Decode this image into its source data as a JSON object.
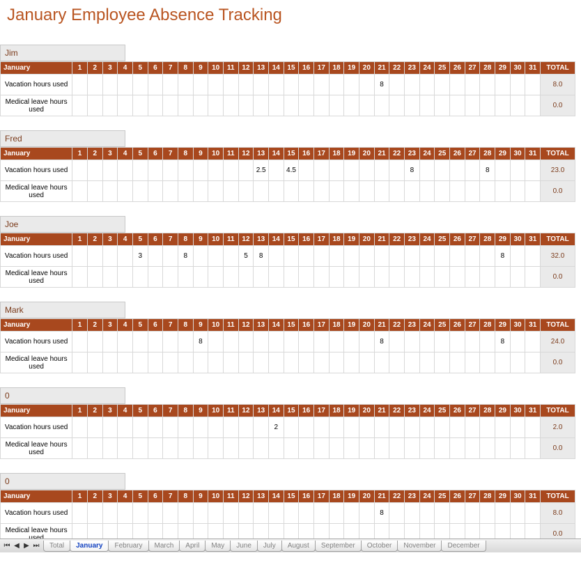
{
  "title": "January Employee Absence Tracking",
  "month_label": "January",
  "total_label": "TOTAL",
  "row_labels": {
    "vacation": "Vacation hours used",
    "medical": "Medical leave hours used"
  },
  "days": [
    "1",
    "2",
    "3",
    "4",
    "5",
    "6",
    "7",
    "8",
    "9",
    "10",
    "11",
    "12",
    "13",
    "14",
    "15",
    "16",
    "17",
    "18",
    "19",
    "20",
    "21",
    "22",
    "23",
    "24",
    "25",
    "26",
    "27",
    "28",
    "29",
    "30",
    "31"
  ],
  "employees": [
    {
      "name": "Jim",
      "vacation": {
        "21": "8"
      },
      "vacation_total": "8.0",
      "medical": {},
      "medical_total": "0.0"
    },
    {
      "name": "Fred",
      "vacation": {
        "13": "2.5",
        "15": "4.5",
        "23": "8",
        "28": "8"
      },
      "vacation_total": "23.0",
      "medical": {},
      "medical_total": "0.0"
    },
    {
      "name": "Joe",
      "vacation": {
        "5": "3",
        "8": "8",
        "12": "5",
        "13": "8",
        "29": "8"
      },
      "vacation_total": "32.0",
      "medical": {},
      "medical_total": "0.0"
    },
    {
      "name": "Mark",
      "vacation": {
        "9": "8",
        "21": "8",
        "29": "8"
      },
      "vacation_total": "24.0",
      "medical": {},
      "medical_total": "0.0"
    },
    {
      "name": "0",
      "vacation": {
        "14": "2"
      },
      "vacation_total": "2.0",
      "medical": {},
      "medical_total": "0.0"
    },
    {
      "name": "0",
      "vacation": {
        "21": "8"
      },
      "vacation_total": "8.0",
      "medical": {},
      "medical_total": "0.0"
    }
  ],
  "tabs": [
    "Total",
    "January",
    "February",
    "March",
    "April",
    "May",
    "June",
    "July",
    "August",
    "September",
    "October",
    "November",
    "December"
  ],
  "active_tab": "January",
  "chart_data": {
    "type": "table",
    "title": "January Employee Absence Tracking",
    "columns": [
      "Employee",
      "Metric",
      "1",
      "2",
      "3",
      "4",
      "5",
      "6",
      "7",
      "8",
      "9",
      "10",
      "11",
      "12",
      "13",
      "14",
      "15",
      "16",
      "17",
      "18",
      "19",
      "20",
      "21",
      "22",
      "23",
      "24",
      "25",
      "26",
      "27",
      "28",
      "29",
      "30",
      "31",
      "TOTAL"
    ],
    "rows": [
      [
        "Jim",
        "Vacation hours used",
        "",
        "",
        "",
        "",
        "",
        "",
        "",
        "",
        "",
        "",
        "",
        "",
        "",
        "",
        "",
        "",
        "",
        "",
        "",
        "",
        "8",
        "",
        "",
        "",
        "",
        "",
        "",
        "",
        "",
        "",
        "",
        "8.0"
      ],
      [
        "Jim",
        "Medical leave hours used",
        "",
        "",
        "",
        "",
        "",
        "",
        "",
        "",
        "",
        "",
        "",
        "",
        "",
        "",
        "",
        "",
        "",
        "",
        "",
        "",
        "",
        "",
        "",
        "",
        "",
        "",
        "",
        "",
        "",
        "",
        "",
        "0.0"
      ],
      [
        "Fred",
        "Vacation hours used",
        "",
        "",
        "",
        "",
        "",
        "",
        "",
        "",
        "",
        "",
        "",
        "",
        "2.5",
        "",
        "4.5",
        "",
        "",
        "",
        "",
        "",
        "",
        "",
        "8",
        "",
        "",
        "",
        "",
        "8",
        "",
        "",
        "",
        "23.0"
      ],
      [
        "Fred",
        "Medical leave hours used",
        "",
        "",
        "",
        "",
        "",
        "",
        "",
        "",
        "",
        "",
        "",
        "",
        "",
        "",
        "",
        "",
        "",
        "",
        "",
        "",
        "",
        "",
        "",
        "",
        "",
        "",
        "",
        "",
        "",
        "",
        "",
        "0.0"
      ],
      [
        "Joe",
        "Vacation hours used",
        "",
        "",
        "",
        "",
        "3",
        "",
        "",
        "8",
        "",
        "",
        "",
        "5",
        "8",
        "",
        "",
        "",
        "",
        "",
        "",
        "",
        "",
        "",
        "",
        "",
        "",
        "",
        "",
        "",
        "8",
        "",
        "",
        "32.0"
      ],
      [
        "Joe",
        "Medical leave hours used",
        "",
        "",
        "",
        "",
        "",
        "",
        "",
        "",
        "",
        "",
        "",
        "",
        "",
        "",
        "",
        "",
        "",
        "",
        "",
        "",
        "",
        "",
        "",
        "",
        "",
        "",
        "",
        "",
        "",
        "",
        "",
        "0.0"
      ],
      [
        "Mark",
        "Vacation hours used",
        "",
        "",
        "",
        "",
        "",
        "",
        "",
        "",
        "8",
        "",
        "",
        "",
        "",
        "",
        "",
        "",
        "",
        "",
        "",
        "",
        "8",
        "",
        "",
        "",
        "",
        "",
        "",
        "",
        "8",
        "",
        "",
        "24.0"
      ],
      [
        "Mark",
        "Medical leave hours used",
        "",
        "",
        "",
        "",
        "",
        "",
        "",
        "",
        "",
        "",
        "",
        "",
        "",
        "",
        "",
        "",
        "",
        "",
        "",
        "",
        "",
        "",
        "",
        "",
        "",
        "",
        "",
        "",
        "",
        "",
        "",
        "0.0"
      ],
      [
        "0",
        "Vacation hours used",
        "",
        "",
        "",
        "",
        "",
        "",
        "",
        "",
        "",
        "",
        "",
        "",
        "",
        "2",
        "",
        "",
        "",
        "",
        "",
        "",
        "",
        "",
        "",
        "",
        "",
        "",
        "",
        "",
        "",
        "",
        "",
        "2.0"
      ],
      [
        "0",
        "Medical leave hours used",
        "",
        "",
        "",
        "",
        "",
        "",
        "",
        "",
        "",
        "",
        "",
        "",
        "",
        "",
        "",
        "",
        "",
        "",
        "",
        "",
        "",
        "",
        "",
        "",
        "",
        "",
        "",
        "",
        "",
        "",
        "",
        "0.0"
      ],
      [
        "0",
        "Vacation hours used",
        "",
        "",
        "",
        "",
        "",
        "",
        "",
        "",
        "",
        "",
        "",
        "",
        "",
        "",
        "",
        "",
        "",
        "",
        "",
        "",
        "8",
        "",
        "",
        "",
        "",
        "",
        "",
        "",
        "",
        "",
        "",
        "8.0"
      ],
      [
        "0",
        "Medical leave hours used",
        "",
        "",
        "",
        "",
        "",
        "",
        "",
        "",
        "",
        "",
        "",
        "",
        "",
        "",
        "",
        "",
        "",
        "",
        "",
        "",
        "",
        "",
        "",
        "",
        "",
        "",
        "",
        "",
        "",
        "",
        "",
        "0.0"
      ]
    ]
  }
}
